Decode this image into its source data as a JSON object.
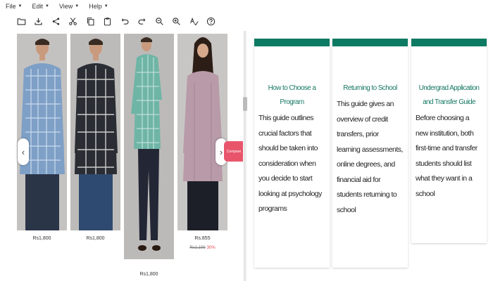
{
  "menu": {
    "items": [
      {
        "label": "File"
      },
      {
        "label": "Edit"
      },
      {
        "label": "View"
      },
      {
        "label": "Help"
      }
    ]
  },
  "toolbar": {
    "buttons": [
      {
        "icon": "folder-open-icon"
      },
      {
        "icon": "download-icon"
      },
      {
        "icon": "share-icon"
      },
      {
        "icon": "scissors-icon"
      },
      {
        "icon": "copy-icon"
      },
      {
        "icon": "clipboard-icon"
      },
      {
        "icon": "undo-icon"
      },
      {
        "icon": "redo-icon"
      },
      {
        "icon": "zoom-out-icon"
      },
      {
        "icon": "zoom-in-icon"
      },
      {
        "icon": "spell-check-icon"
      },
      {
        "icon": "help-icon"
      }
    ]
  },
  "carousel": {
    "products": [
      {
        "price": "Rs1,800",
        "shirt_color": "#7ea0c7"
      },
      {
        "price": "Rs1,800",
        "shirt_color": "#2a2d33"
      },
      {
        "price": "Rs1,800",
        "shirt_color": "#6fb5a6"
      },
      {
        "price": "Rs.855",
        "old_price": "Rs1,199",
        "discount": "30%",
        "shirt_color": "#b89aa8"
      }
    ],
    "compare_label": "Compare"
  },
  "cards": [
    {
      "title": "How to Choose a Program",
      "body": "This guide outlines crucial factors that should be taken into consideration when you decide to start looking at psychology programs"
    },
    {
      "title": "Returning to School",
      "body": "This guide gives an overview of credit transfers, prior learning assessments, online degrees, and financial aid for students returning to school"
    },
    {
      "title": "Undergrad Application and Transfer Guide",
      "body": "Before choosing a new institution, both first-time and transfer students should list what they want in a school"
    }
  ],
  "colors": {
    "card_accent": "#0d7a63",
    "card_title": "#1a7a66",
    "compare_tab": "#e8556b"
  }
}
